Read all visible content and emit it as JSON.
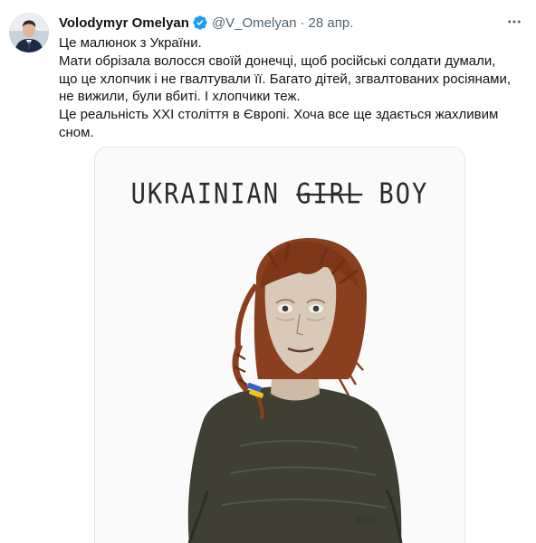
{
  "author": {
    "display_name": "Volodymyr Omelyan",
    "handle": "@V_Omelyan",
    "separator": "·",
    "timestamp": "28 апр.",
    "verified": true
  },
  "tweet": {
    "lines": [
      "Це малюнок з України.",
      "Мати обрізала волосся своїй донечці, щоб російські солдати думали, що це хлопчик і не гвалтували її. Багато дітей, згвалтованих росіянами, не вижили, були вбиті. І хлопчики теж.",
      "Це реальність XXI століття в Європі. Хоча все ще здається жахливим сном."
    ]
  },
  "media": {
    "caption_word_1": "UKRAINIAN",
    "caption_struck": "GIRL",
    "caption_word_3": "BOY",
    "signature": "Billi"
  },
  "colors": {
    "verified_badge": "#1d9bf0",
    "muted_text": "#536471",
    "primary_text": "#0f1419",
    "hair": "#8a3f1e",
    "ribbon_blue": "#2f63c6",
    "ribbon_yellow": "#f2c01b",
    "sweater": "#3f4033"
  },
  "icons": [
    "avatar",
    "verified-badge-icon",
    "more-options-icon"
  ]
}
